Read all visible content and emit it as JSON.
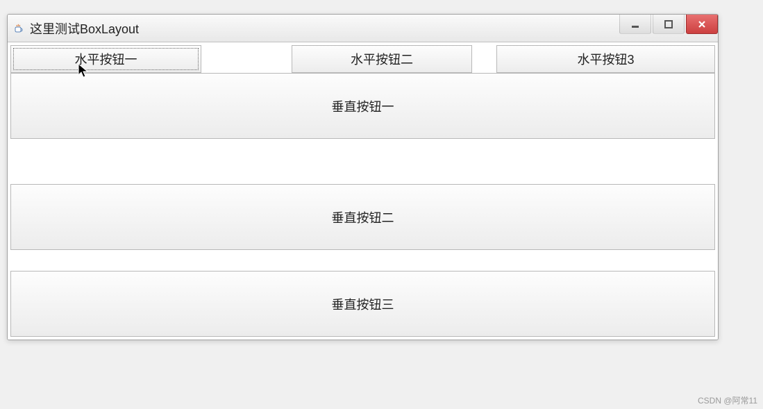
{
  "window": {
    "title": "这里测试BoxLayout"
  },
  "horizontal": {
    "btn1": "水平按钮一",
    "btn2": "水平按钮二",
    "btn3": "水平按钮3"
  },
  "vertical": {
    "btn1": "垂直按钮一",
    "btn2": "垂直按钮二",
    "btn3": "垂直按钮三"
  },
  "watermark": "CSDN @阿常11"
}
